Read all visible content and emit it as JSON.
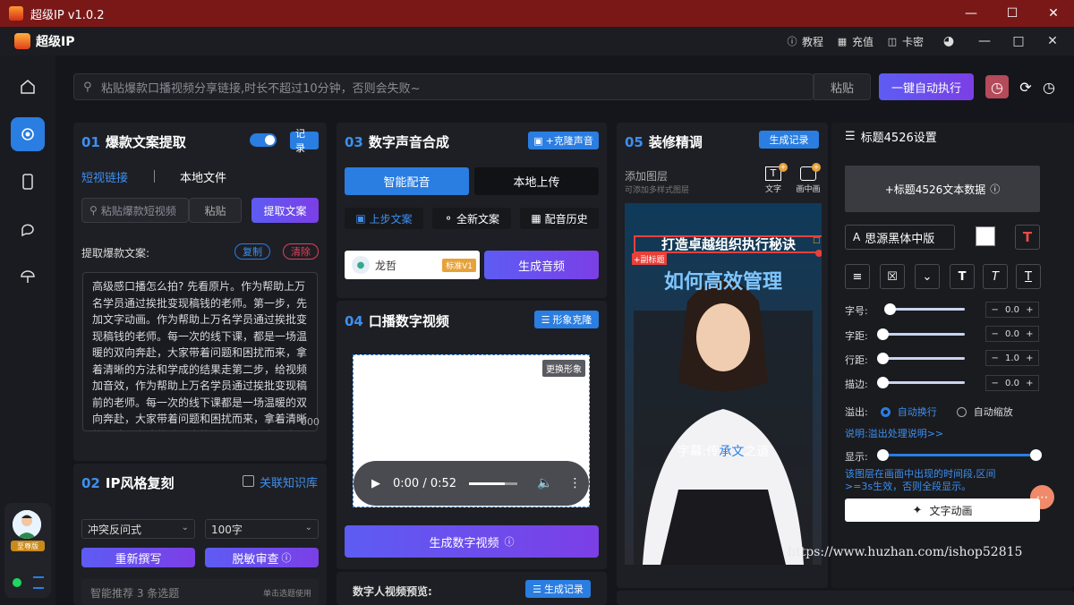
{
  "window": {
    "title": "超级IP v1.0.2"
  },
  "app_bar": {
    "name": "超级IP",
    "tutorial": "教程",
    "recharge": "充值",
    "card_key": "卡密"
  },
  "top": {
    "search_placeholder": "粘贴爆款口播视频分享链接,时长不超过10分钟，否则会失败~",
    "paste": "粘贴",
    "auto_exec": "一键自动执行"
  },
  "user": {
    "badge": "至尊版"
  },
  "s01": {
    "num": "01",
    "title": "爆款文案提取",
    "record": "记录",
    "tab_video": "短视链接",
    "tab_local": "本地文件",
    "input_placeholder": "粘贴爆款短视频",
    "paste": "粘贴",
    "extract": "提取文案",
    "label": "提取爆款文案:",
    "copy": "复制",
    "clear": "清除",
    "content": "高级感口播怎么拍? 先看原片。作为帮助上万名学员通过挨批变现稿钱的老师。第一步，先加文字动画。作为帮助上万名学员通过挨批变现稿钱的老师。每一次的线下课，都是一场温暖的双向奔赴，大家带着问题和困扰而来，拿着清晰的方法和学成的结果走第二步，给视频加音效，作为帮助上万名学员通过挨批变现稿前的老师。每一次的线下课都是一场温暖的双向奔赴，大家带着问题和困扰而来，拿着清晰的方法和学成的结果走第三步，加画中画素材，请看成片，作为帮助",
    "counter": "000"
  },
  "s02": {
    "num": "02",
    "title": "IP风格复刻",
    "kb": "关联知识库",
    "style": "冲突反问式",
    "length": "100字",
    "rewrite": "重新撰写",
    "review": "脱敏审查",
    "hint": "智能推荐 3 条选题",
    "hint_right": "单击选题使用"
  },
  "s03": {
    "num": "03",
    "title": "数字声音合成",
    "clone_voice": "+克隆声音",
    "tab_smart": "智能配音",
    "tab_upload": "本地上传",
    "prev_text": "上步文案",
    "new_text": "全新文案",
    "history": "配音历史",
    "voice_name": "龙哲",
    "voice_tag": "标准V1",
    "gen_audio": "生成音频"
  },
  "s04": {
    "num": "04",
    "title": "口播数字视频",
    "clone_image": "形象克隆",
    "change_image": "更换形象",
    "time": "0:00 / 0:52",
    "gen_video": "生成数字视频",
    "preview_label": "数字人视频预览:",
    "gen_record": "生成记录"
  },
  "s05": {
    "num": "05",
    "title": "装修精调",
    "gen_record": "生成记录",
    "add_layer": "添加图层",
    "add_layer_sub": "可添加多样式图层",
    "text_tool": "文字",
    "pip_tool": "画中画",
    "overlay_title": "打造卓越组织执行秘诀",
    "sub_title_tag": "+副标题",
    "main_title": "如何高效管理",
    "subtitle_prefix": "字幕:传",
    "subtitle_hl": "承文",
    "subtitle_suffix": "之道"
  },
  "settings": {
    "title": "标题4526设置",
    "data_btn": "+标题4526文本数据",
    "font": "思源黑体中版",
    "size_label": "字号:",
    "spacing_label": "字距:",
    "line_label": "行距:",
    "stroke_label": "描边:",
    "size": "0.0",
    "spacing": "0.0",
    "line": "1.0",
    "stroke": "0.0",
    "overflow_label": "溢出:",
    "wrap": "自动换行",
    "shrink": "自动缩放",
    "explain": "说明:溢出处理说明>>",
    "show_label": "显示:",
    "show_note": "该图层在画面中出现的时间段,区间>=3s生效，否则全段显示。",
    "text_anim": "文字动画"
  },
  "watermark": "https://www.huzhan.com/ishop52815"
}
